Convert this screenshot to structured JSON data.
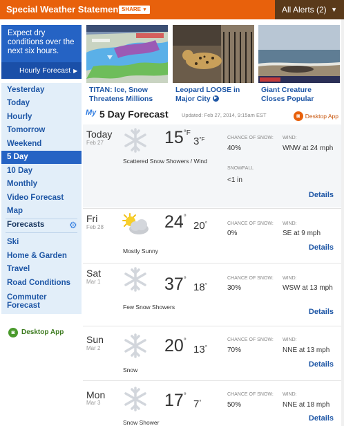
{
  "header": {
    "title": "Special Weather Statement",
    "share_label": "SHARE",
    "alerts_label": "All Alerts (2)"
  },
  "statement": {
    "message": "Expect dry conditions over the next six hours.",
    "hourly_link": "Hourly Forecast"
  },
  "nav": {
    "items": [
      "Yesterday",
      "Today",
      "Hourly",
      "Tomorrow",
      "Weekend",
      "5 Day",
      "10 Day",
      "Monthly",
      "Video Forecast",
      "Map"
    ],
    "active": "5 Day",
    "forecasts_heading": "Forecasts",
    "forecast_links": [
      "Ski",
      "Home & Garden",
      "Travel",
      "Road Conditions",
      "Commuter Forecast"
    ]
  },
  "desktop_app_label": "Desktop App",
  "news": [
    {
      "line1": "TITAN: Ice, Snow",
      "line2": "Threatens Millions",
      "image": "winter-storm-map"
    },
    {
      "line1": "Leopard LOOSE in",
      "line2": "Major City",
      "image": "leopard-photo"
    },
    {
      "line1": "Giant Creature",
      "line2": "Closes Popular",
      "image": "beach-creature-photo"
    }
  ],
  "forecast": {
    "my_label": "My",
    "title": "5 Day Forecast",
    "updated": "Updated: Feb 27, 2014, 9:15am EST",
    "desktop_app_label": "Desktop App",
    "snow_label": "CHANCE OF SNOW:",
    "wind_label": "WIND:",
    "snowfall_label": "SNOWFALL",
    "details_label": "Details",
    "days": [
      {
        "name": "Today",
        "date": "Feb 27",
        "hi": "15",
        "hi_unit": "°F",
        "lo": "3",
        "lo_unit": "°F",
        "icon": "snowflake-icon",
        "condition": "Scattered Snow Showers / Wind",
        "snow_chance": "40%",
        "wind": "WNW at 24 mph",
        "snowfall": "<1 in"
      },
      {
        "name": "Fri",
        "date": "Feb 28",
        "hi": "24",
        "hi_unit": "°",
        "lo": "20",
        "lo_unit": "°",
        "icon": "sun-cloud-icon",
        "condition": "Mostly Sunny",
        "snow_chance": "0%",
        "wind": "SE at 9 mph"
      },
      {
        "name": "Sat",
        "date": "Mar 1",
        "hi": "37",
        "hi_unit": "°",
        "lo": "18",
        "lo_unit": "°",
        "icon": "snowflake-icon",
        "condition": "Few Snow Showers",
        "snow_chance": "30%",
        "wind": "WSW at 13 mph"
      },
      {
        "name": "Sun",
        "date": "Mar 2",
        "hi": "20",
        "hi_unit": "°",
        "lo": "13",
        "lo_unit": "°",
        "icon": "snowflake-icon",
        "condition": "Snow",
        "snow_chance": "70%",
        "wind": "NNE at 13 mph"
      },
      {
        "name": "Mon",
        "date": "Mar 3",
        "hi": "17",
        "hi_unit": "°",
        "lo": "7",
        "lo_unit": "°",
        "icon": "snowflake-icon",
        "condition": "Snow Shower",
        "snow_chance": "50%",
        "wind": "NNE at 18 mph"
      }
    ]
  },
  "colors": {
    "header_orange": "#e8610c",
    "alerts_brown": "#5a3a1a",
    "nav_blue": "#2563c4",
    "link_blue": "#1f57a6",
    "sidebar_bg": "#e2eef9",
    "desktop_green": "#4a9a2c"
  }
}
